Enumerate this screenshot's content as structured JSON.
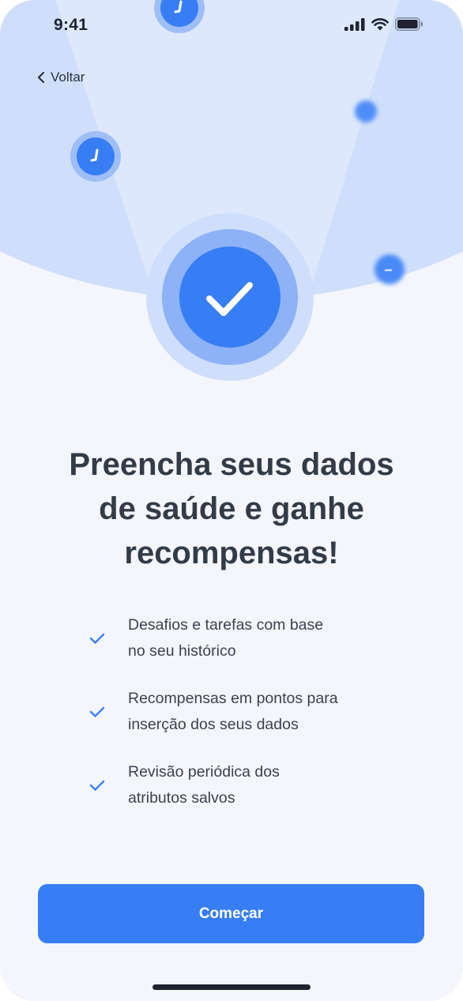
{
  "status_bar": {
    "time": "9:41",
    "icons": [
      "cellular-signal-icon",
      "wifi-icon",
      "battery-icon"
    ]
  },
  "nav": {
    "back_label": "Voltar",
    "back_icon": "chevron-left-icon"
  },
  "hero": {
    "icon": "checkmark-icon"
  },
  "title": "Preencha seus dados\nde saúde e ganhe\nrecompensas!",
  "features": [
    {
      "icon": "check-icon",
      "text": "Desafios e tarefas com base\nno seu histórico"
    },
    {
      "icon": "check-icon",
      "text": "Recompensas em pontos para\ninserção dos seus dados"
    },
    {
      "icon": "check-icon",
      "text": "Revisão periódica dos\natributos salvos"
    }
  ],
  "cta": {
    "label": "Começar"
  },
  "colors": {
    "accent": "#377ef5",
    "background": "#f4f6fb",
    "header_bg": "#cfdffb",
    "text_dark": "#333a48",
    "text_body": "#3a4150"
  }
}
